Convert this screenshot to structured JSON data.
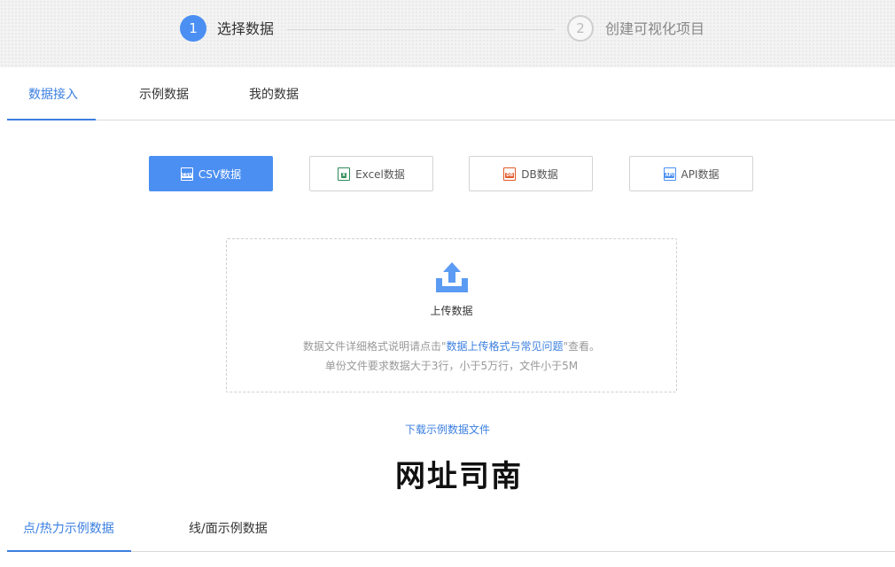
{
  "stepper": {
    "step1": {
      "number": "1",
      "label": "选择数据"
    },
    "step2": {
      "number": "2",
      "label": "创建可视化项目"
    }
  },
  "tabs": [
    {
      "label": "数据接入",
      "active": true
    },
    {
      "label": "示例数据",
      "active": false
    },
    {
      "label": "我的数据",
      "active": false
    }
  ],
  "data_types": [
    {
      "label": "CSV数据",
      "icon": "csv-file-icon",
      "icon_text": "CSV",
      "color": "#4b8ff2",
      "active": true
    },
    {
      "label": "Excel数据",
      "icon": "excel-file-icon",
      "icon_text": "X",
      "color": "#2e8b57",
      "active": false
    },
    {
      "label": "DB数据",
      "icon": "db-file-icon",
      "icon_text": "DB",
      "color": "#e05a2b",
      "active": false
    },
    {
      "label": "API数据",
      "icon": "api-file-icon",
      "icon_text": "API",
      "color": "#4b8ff2",
      "active": false
    }
  ],
  "upload": {
    "icon": "upload-icon",
    "title": "上传数据",
    "help_prefix": "数据文件详细格式说明请点击\"",
    "help_link": "数据上传格式与常见问题",
    "help_suffix": "\"查看。",
    "requirements": "单份文件要求数据大于3行，小于5万行，文件小于5M"
  },
  "download_link": "下载示例数据文件",
  "watermark": "网址司南",
  "bottom_tabs": [
    {
      "label": "点/热力示例数据",
      "active": true
    },
    {
      "label": "线/面示例数据",
      "active": false
    }
  ],
  "colors": {
    "accent": "#3b7fe0",
    "primary_button": "#4b8ff2"
  }
}
